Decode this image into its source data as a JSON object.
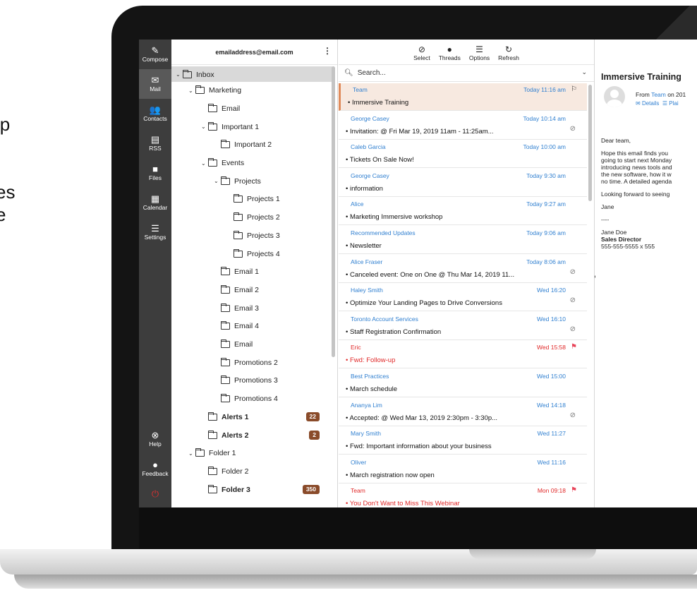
{
  "side_text": [
    "lp",
    "l",
    "es",
    "e"
  ],
  "rail": {
    "items": [
      {
        "label": "Compose",
        "icon": "compose-icon",
        "glyph": "✎"
      },
      {
        "label": "Mail",
        "icon": "mail-icon",
        "glyph": "✉"
      },
      {
        "label": "Contacts",
        "icon": "contacts-icon",
        "glyph": "👥"
      },
      {
        "label": "RSS",
        "icon": "rss-icon",
        "glyph": "▤"
      },
      {
        "label": "Files",
        "icon": "files-icon",
        "glyph": "■"
      },
      {
        "label": "Calendar",
        "icon": "calendar-icon",
        "glyph": "▦"
      },
      {
        "label": "Settings",
        "icon": "settings-icon",
        "glyph": "☰"
      }
    ],
    "bottom": [
      {
        "label": "Help",
        "icon": "help-icon",
        "glyph": "⊗"
      },
      {
        "label": "Feedback",
        "icon": "feedback-icon",
        "glyph": "●"
      },
      {
        "label": "",
        "icon": "power-icon",
        "glyph": "⏻"
      }
    ]
  },
  "folders": {
    "account": "emailaddress@email.com",
    "items": [
      {
        "label": "Inbox",
        "chevron": true,
        "level": 0
      },
      {
        "label": "Marketing",
        "chevron": true,
        "level": 1
      },
      {
        "label": "Email",
        "chevron": false,
        "level": 2
      },
      {
        "label": "Important 1",
        "chevron": true,
        "level": 2
      },
      {
        "label": "Important 2",
        "chevron": false,
        "level": 3
      },
      {
        "label": "Events",
        "chevron": true,
        "level": 2
      },
      {
        "label": "Projects",
        "chevron": true,
        "level": 3
      },
      {
        "label": "Projects 1",
        "chevron": false,
        "level": 4
      },
      {
        "label": "Projects 2",
        "chevron": false,
        "level": 4
      },
      {
        "label": "Projects 3",
        "chevron": false,
        "level": 4
      },
      {
        "label": "Projects 4",
        "chevron": false,
        "level": 4
      },
      {
        "label": "Email 1",
        "chevron": false,
        "level": 3
      },
      {
        "label": "Email 2",
        "chevron": false,
        "level": 3
      },
      {
        "label": "Email 3",
        "chevron": false,
        "level": 3
      },
      {
        "label": "Email 4",
        "chevron": false,
        "level": 3
      },
      {
        "label": "Email",
        "chevron": false,
        "level": 3
      },
      {
        "label": "Promotions 2",
        "chevron": false,
        "level": 3
      },
      {
        "label": "Promotions 3",
        "chevron": false,
        "level": 3
      },
      {
        "label": "Promotions 4",
        "chevron": false,
        "level": 3
      },
      {
        "label": "Alerts 1",
        "chevron": false,
        "level": 2,
        "bold": true,
        "badge": "22"
      },
      {
        "label": "Alerts 2",
        "chevron": false,
        "level": 2,
        "bold": true,
        "badge": "2"
      },
      {
        "label": "Folder 1",
        "chevron": true,
        "level": 1
      },
      {
        "label": "Folder 2",
        "chevron": false,
        "level": 2
      },
      {
        "label": "Folder 3",
        "chevron": false,
        "level": 2,
        "bold": true,
        "badge": "350"
      }
    ]
  },
  "toolbar": {
    "select": "Select",
    "threads": "Threads",
    "options": "Options",
    "refresh": "Refresh"
  },
  "search": {
    "placeholder": "Search..."
  },
  "messages": [
    {
      "sender": "Team",
      "time": "Today 11:16 am",
      "subject": "Immersive Training",
      "selected": true,
      "flag": "outline"
    },
    {
      "sender": "George  Casey",
      "time": "Today 10:14 am",
      "subject": "Invitation: @ Fri Mar 19, 2019 11am - 11:25am...",
      "attach": true
    },
    {
      "sender": "Caleb Garcia",
      "time": "Today 10:00 am",
      "subject": "Tickets On Sale Now!"
    },
    {
      "sender": "George  Casey",
      "time": "Today 9:30 am",
      "subject": "information"
    },
    {
      "sender": "Alice",
      "time": "Today 9:27 am",
      "subject": "Marketing Immersive workshop"
    },
    {
      "sender": "Recommended Updates",
      "time": "Today 9:06 am",
      "subject": "Newsletter"
    },
    {
      "sender": "Alice Fraser",
      "time": "Today 8:06 am",
      "subject": "Canceled event: One on One @ Thu Mar 14, 2019 11...",
      "attach": true
    },
    {
      "sender": "Haley Smith",
      "time": "Wed 16:20",
      "subject": "Optimize Your Landing Pages to Drive Conversions",
      "attach": true
    },
    {
      "sender": "Toronto  Account Services",
      "time": "Wed 16:10",
      "subject": "Staff Registration Confirmation",
      "attach": true
    },
    {
      "sender": "Eric",
      "time": "Wed 15:58",
      "subject": "Fwd: Follow-up",
      "red": true,
      "flag": "red"
    },
    {
      "sender": "Best Practices",
      "time": "Wed 15:00",
      "subject": "March schedule"
    },
    {
      "sender": "Ananya  Lim",
      "time": "Wed 14:18",
      "subject": "Accepted: @ Wed Mar 13, 2019 2:30pm - 3:30p...",
      "attach": true
    },
    {
      "sender": "Mary Smith",
      "time": "Wed 11:27",
      "subject": "Fwd: Important information about your business"
    },
    {
      "sender": "Oliver",
      "time": "Wed 11:16",
      "subject": "March registration now open"
    },
    {
      "sender": "Team",
      "time": "Mon 09:18",
      "subject": "You Don't Want to Miss This Webinar",
      "red": true,
      "flag": "red"
    }
  ],
  "reading": {
    "title": "Immersive Training",
    "from_prefix": "From",
    "from_name": "Team",
    "from_suffix": "on 201",
    "details": "Details",
    "plain": "Plai",
    "body": [
      "Dear team,",
      "Hope this email finds you",
      "going to start next Monday",
      "introducing news tools and",
      "the new software, how it w",
      "no time. A detailed agenda",
      "Looking forward to seeing",
      "Jane",
      "----",
      "Jane Doe",
      "Sales Director",
      "555-555-5555 x 555"
    ]
  },
  "colors": {
    "accent": "#2f7fd0",
    "alert": "#e02828",
    "badge": "#8a4b2a",
    "rail": "#3d3d3d"
  }
}
